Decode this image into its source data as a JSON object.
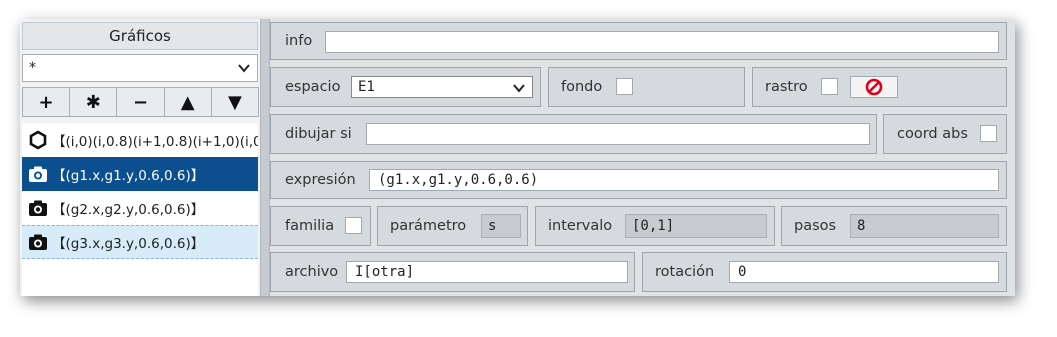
{
  "panel": {
    "title": "Gráficos",
    "filter_value": "*",
    "tools": [
      "+",
      "✱",
      "−",
      "▲",
      "▼"
    ],
    "items": [
      {
        "icon": "hexagon-icon",
        "text": "【(i,0)(i,0.8)(i+1,0.8)(i+1,0)(i,0",
        "selected": false
      },
      {
        "icon": "camera-icon",
        "text": "【(g1.x,g1.y,0.6,0.6)】",
        "selected": true
      },
      {
        "icon": "camera-icon",
        "text": "【(g2.x,g2.y,0.6,0.6)】",
        "selected": false
      },
      {
        "icon": "camera-icon",
        "text": "【(g3.x,g3.y,0.6,0.6)】",
        "selected": false
      }
    ]
  },
  "form": {
    "info_label": "info",
    "info_value": "",
    "espacio_label": "espacio",
    "espacio_value": "E1",
    "fondo_label": "fondo",
    "rastro_label": "rastro",
    "dibujar_label": "dibujar si",
    "dibujar_value": "",
    "coord_abs_label": "coord abs",
    "expresion_label": "expresión",
    "expresion_value": "(g1.x,g1.y,0.6,0.6)",
    "familia_label": "familia",
    "parametro_label": "parámetro",
    "parametro_value": "s",
    "intervalo_label": "intervalo",
    "intervalo_value": "[0,1]",
    "pasos_label": "pasos",
    "pasos_value": "8",
    "archivo_label": "archivo",
    "archivo_value": "I[otra]",
    "rotacion_label": "rotación",
    "rotacion_value": "0"
  },
  "colors": {
    "selection": "#0b4f8f",
    "alt_row": "#d7ecf8",
    "no_entry_red": "#e0001a"
  }
}
